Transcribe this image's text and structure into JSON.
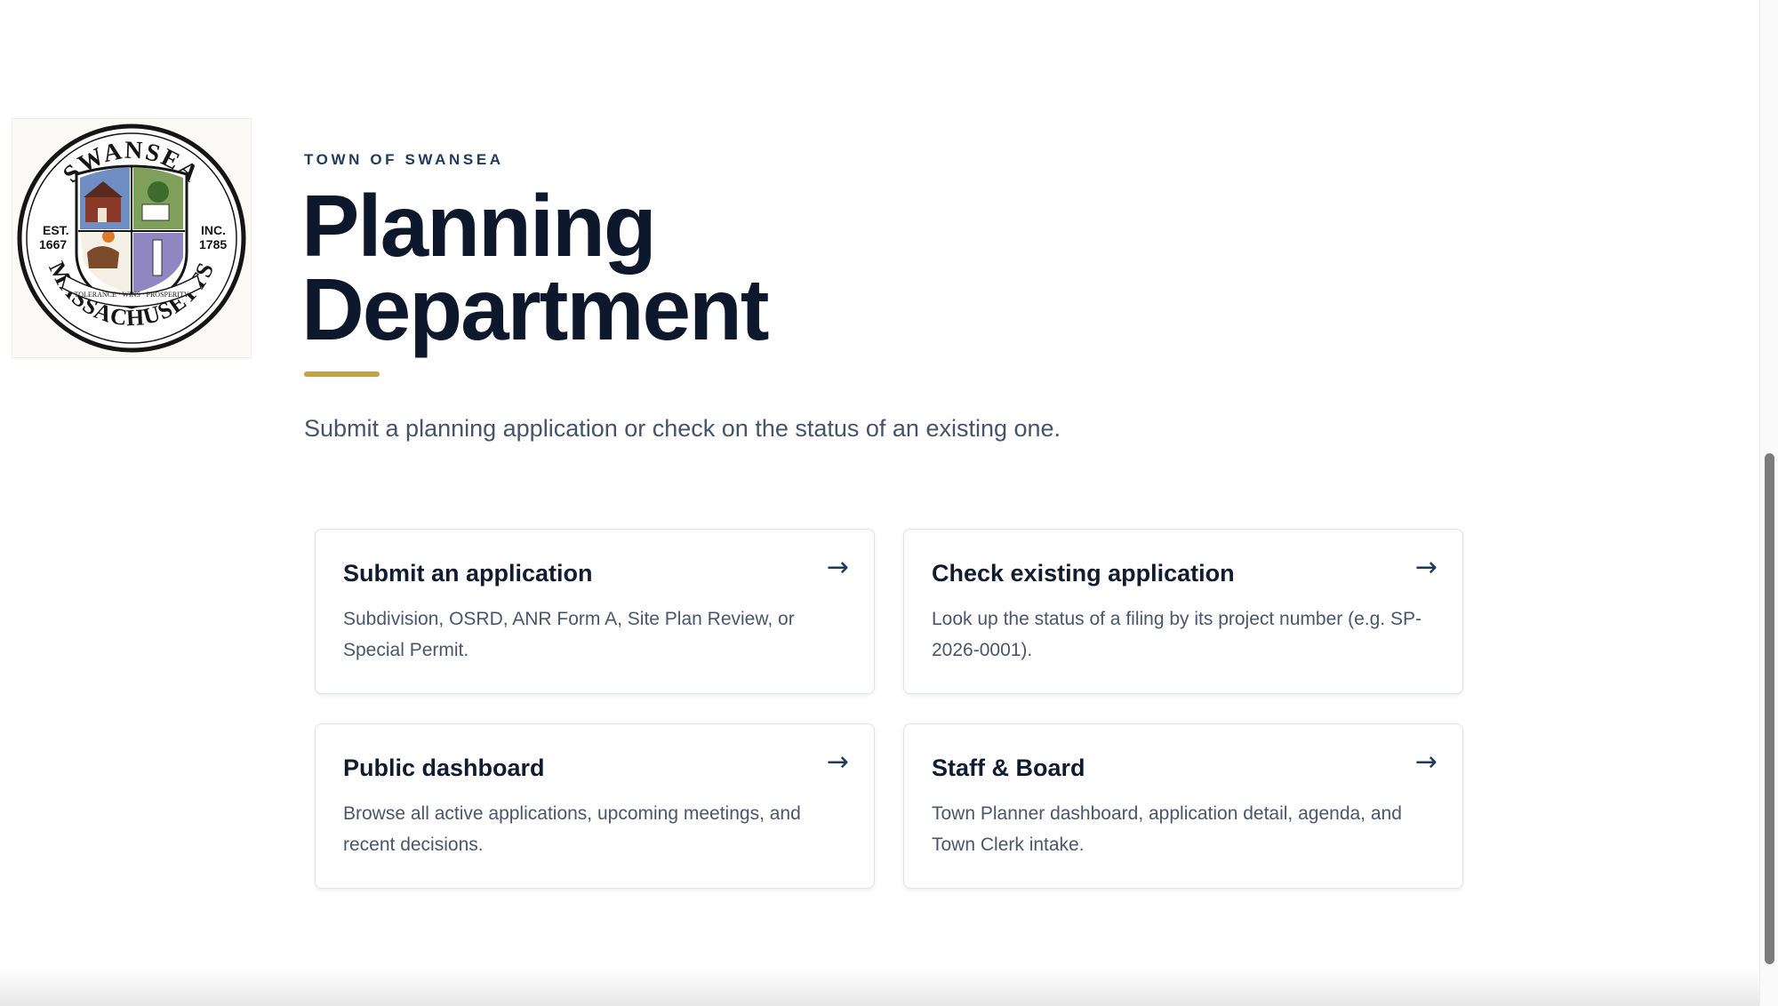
{
  "seal": {
    "top_text": "SWANSEA",
    "bottom_text": "MASSACHUSETTS",
    "left_text": [
      "EST.",
      "1667"
    ],
    "right_text": [
      "INC.",
      "1785"
    ],
    "motto": [
      "TOLERANCE",
      "WINS",
      "PROSPERITY"
    ]
  },
  "header": {
    "eyebrow": "TOWN OF SWANSEA",
    "title_line1": "Planning",
    "title_line2": "Department",
    "intro": "Submit a planning application or check on the status of an existing one."
  },
  "cards": [
    {
      "title": "Submit an application",
      "description": "Subdivision, OSRD, ANR Form A, Site Plan Review, or Special Permit.",
      "arrow": "→"
    },
    {
      "title": "Check existing application",
      "description": "Look up the status of a filing by its project number (e.g. SP-2026-0001).",
      "arrow": "→"
    },
    {
      "title": "Public dashboard",
      "description": "Browse all active applications, upcoming meetings, and recent decisions.",
      "arrow": "→"
    },
    {
      "title": "Staff & Board",
      "description": "Town Planner dashboard, application detail, agenda, and Town Clerk intake.",
      "arrow": "→"
    }
  ],
  "colors": {
    "accent_gold": "#c3a24c",
    "heading_navy": "#0e182c",
    "eyebrow_blue": "#1f3a5c",
    "body_text": "#44546b"
  },
  "icons": {
    "card_arrow": "arrow-right-icon",
    "seal": "town-seal-logo"
  }
}
